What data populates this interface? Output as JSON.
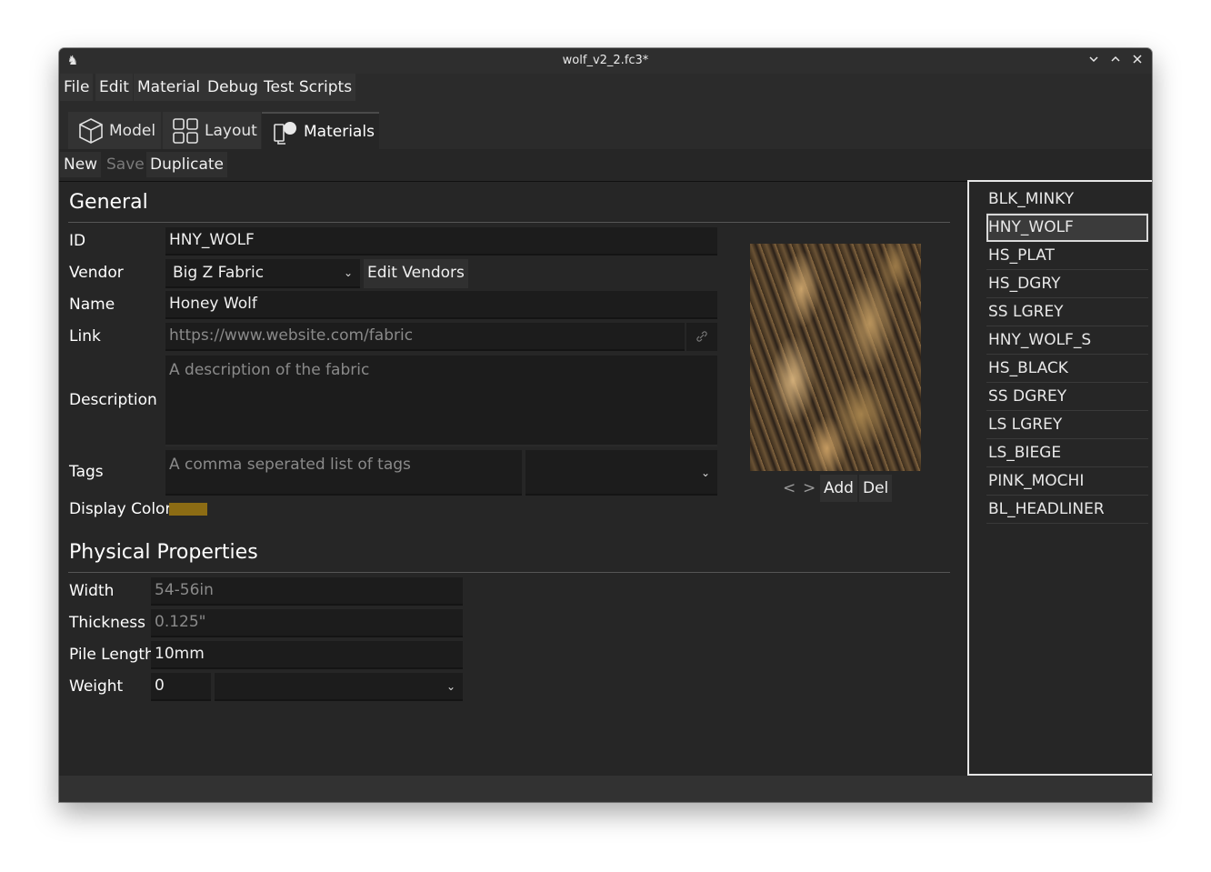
{
  "window": {
    "title": "wolf_v2_2.fc3*",
    "controls": [
      "chevron-down-icon",
      "chevron-up-icon",
      "close-icon"
    ]
  },
  "menu": [
    "File",
    "Edit",
    "Material",
    "Debug",
    "Test Scripts"
  ],
  "tabs": [
    {
      "label": "Model",
      "icon": "cube-icon",
      "active": false
    },
    {
      "label": "Layout",
      "icon": "grid-icon",
      "active": false
    },
    {
      "label": "Materials",
      "icon": "materials-icon",
      "active": true
    }
  ],
  "toolbar": {
    "new": "New",
    "save": "Save",
    "duplicate": "Duplicate"
  },
  "general": {
    "title": "General",
    "id_label": "ID",
    "id_value": "HNY_WOLF",
    "vendor_label": "Vendor",
    "vendor_value": "Big Z Fabric",
    "edit_vendors": "Edit Vendors",
    "name_label": "Name",
    "name_value": "Honey Wolf",
    "link_label": "Link",
    "link_placeholder": "https://www.website.com/fabric",
    "description_label": "Description",
    "description_placeholder": "A description of the fabric",
    "tags_label": "Tags",
    "tags_placeholder": "A comma seperated list of tags",
    "display_color_label": "Display Color",
    "display_color": "#8c6c14"
  },
  "image_controls": {
    "prev": "<",
    "next": ">",
    "add": "Add",
    "del": "Del"
  },
  "physical": {
    "title": "Physical Properties",
    "width_label": "Width",
    "width_placeholder": "54-56in",
    "thickness_label": "Thickness",
    "thickness_placeholder": "0.125\"",
    "pile_label": "Pile Length",
    "pile_value": "10mm",
    "weight_label": "Weight",
    "weight_value": "0"
  },
  "materials": [
    "BLK_MINKY",
    "HNY_WOLF",
    "HS_PLAT",
    "HS_DGRY",
    "SS LGREY",
    "HNY_WOLF_S",
    "HS_BLACK",
    "SS DGREY",
    "LS LGREY",
    "LS_BIEGE",
    "PINK_MOCHI",
    "BL_HEADLINER"
  ],
  "selected_material": "HNY_WOLF"
}
